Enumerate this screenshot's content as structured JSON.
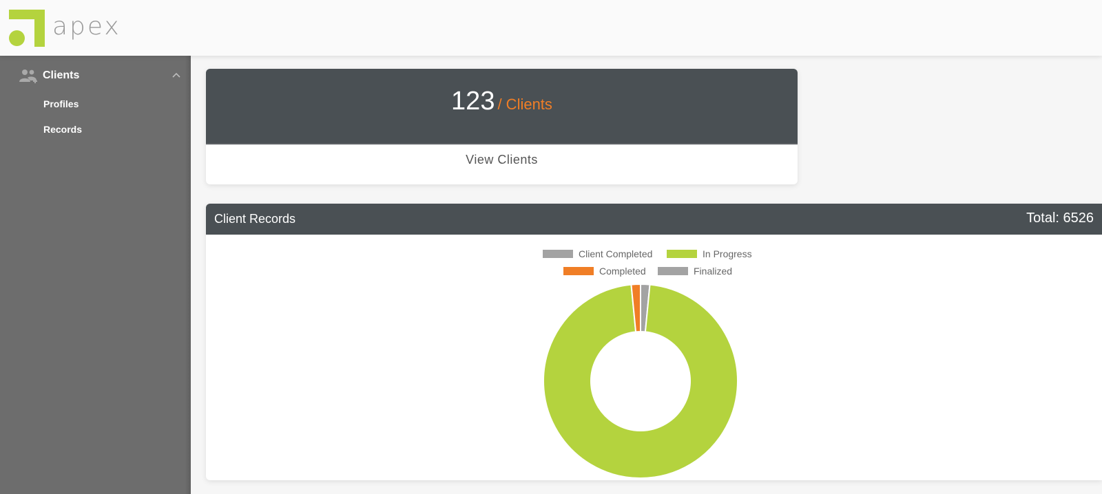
{
  "brand": {
    "name": "apex",
    "color": "#b4d33e"
  },
  "sidebar": {
    "section": {
      "label": "Clients",
      "icon": "users-icon",
      "expanded": true
    },
    "items": [
      {
        "label": "Profiles"
      },
      {
        "label": "Records"
      }
    ]
  },
  "client_card": {
    "count": "123",
    "unit": "/ Clients",
    "link": "View Clients"
  },
  "records_card": {
    "title": "Client Records",
    "total": "Total: 6526"
  },
  "chart_data": {
    "type": "pie",
    "legend": [
      "Client Completed",
      "In Progress",
      "Completed",
      "Finalized"
    ],
    "values": [
      0,
      6326,
      100,
      100
    ],
    "total": 6526,
    "legend_position": "top",
    "colors": {
      "Client Completed": "#a3a3a3",
      "In Progress": "#b4d33e",
      "Completed": "#f07e26",
      "Finalized": "#a3a3a3"
    }
  }
}
